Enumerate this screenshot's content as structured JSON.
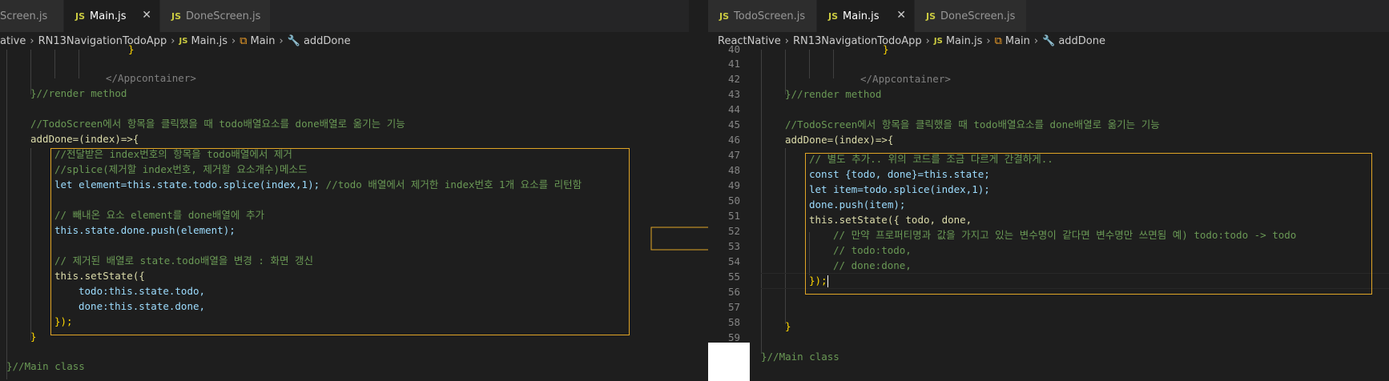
{
  "left": {
    "tabs": [
      {
        "label": "Screen.js",
        "active": false
      },
      {
        "label": "Main.js",
        "active": true
      },
      {
        "label": "DoneScreen.js",
        "active": false
      }
    ],
    "breadcrumb": [
      "ative",
      "RN13NavigationTodoApp",
      "Main.js",
      "Main",
      "addDone"
    ],
    "code": {
      "close_appcontainer": "</Appcontainer>",
      "render_end": "}//render method",
      "comment_feature": "//TodoScreen에서 항목을 클릭했을 때 todo배열요소를 done배열로 옮기는 기능",
      "add_done_decl": "addDone=(index)=>{",
      "c1": "//전달받은 index번호의 항목을 todo배열에서 제거",
      "c2": "//splice(제거할 index번호, 제거할 요소개수)메소드",
      "let_line": "let element=this.state.todo.splice(index,1);",
      "let_comment": " //todo 배열에서 제거한 index번호 1개 요소를 리턴함",
      "c3": "// 빼내온 요소 element를 done배열에 추가",
      "push_line": "this.state.done.push(element);",
      "c4": "// 제거된 배열로 state.todo배열을 변경 : 화면 갱신",
      "setstate_open": "this.setState({",
      "todo_prop": "todo:this.state.todo,",
      "done_prop": "done:this.state.done,",
      "setstate_close": "});",
      "func_close": "}",
      "class_close": "}//Main class"
    }
  },
  "right": {
    "tabs": [
      {
        "label": "TodoScreen.js",
        "active": false
      },
      {
        "label": "Main.js",
        "active": true
      },
      {
        "label": "DoneScreen.js",
        "active": false
      }
    ],
    "breadcrumb": [
      "ReactNative",
      "RN13NavigationTodoApp",
      "Main.js",
      "Main",
      "addDone"
    ],
    "line_numbers": [
      "40",
      "41",
      "42",
      "43",
      "44",
      "45",
      "46",
      "47",
      "48",
      "49",
      "50",
      "51",
      "52",
      "53",
      "54",
      "55",
      "56",
      "57",
      "58",
      "59"
    ],
    "code": {
      "close_appcontainer": "</Appcontainer>",
      "render_end": "}//render method",
      "comment_feature": "//TodoScreen에서 항목을 클릭했을 때 todo배열요소를 done배열로 옮기는 기능",
      "add_done_decl": "addDone=(index)=>{",
      "c1": "// 별도 추가.. 위의 코드를 조금 다르게 간결하게..",
      "const_line": "const {todo, done}=this.state;",
      "let_line": "let item=todo.splice(index,1);",
      "push_line": "done.push(item);",
      "setstate_line": "this.setState({ todo, done,",
      "c2": "// 만약 프로퍼티명과 값을 가지고 있는 변수명이 같다면 변수명만 쓰면됨 예) todo:todo -> todo",
      "c3": "// todo:todo,",
      "c4": "// done:done,",
      "setstate_close": "});",
      "func_close": "}",
      "class_close": "}//Main class"
    }
  },
  "colors": {
    "highlight_box": "#e0a526",
    "comment": "#6a9955",
    "keyword": "#569cd6"
  }
}
